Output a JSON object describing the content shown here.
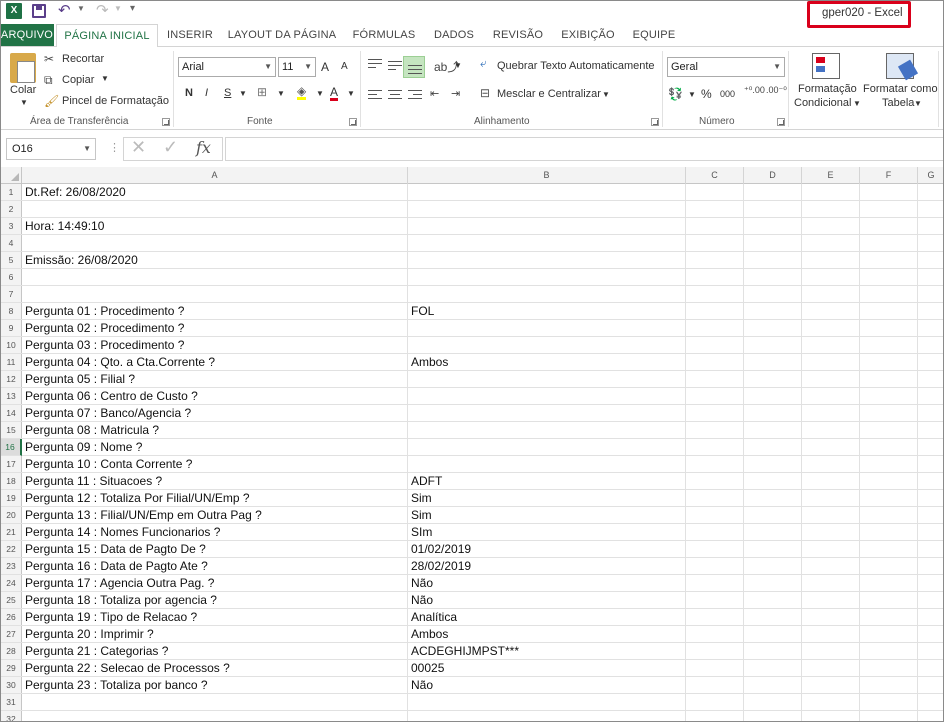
{
  "title_bar": {
    "title": "gper020 - Excel"
  },
  "quick_access": {
    "logo_letter": "X"
  },
  "ribbon_tabs": [
    "ARQUIVO",
    "PÁGINA INICIAL",
    "INSERIR",
    "LAYOUT DA PÁGINA",
    "FÓRMULAS",
    "DADOS",
    "REVISÃO",
    "EXIBIÇÃO",
    "EQUIPE"
  ],
  "clipboard": {
    "paste": "Colar",
    "cut": "Recortar",
    "copy": "Copiar",
    "format_painter": "Pincel de Formatação",
    "group_label": "Área de Transferência"
  },
  "font": {
    "name": "Arial",
    "size": "11",
    "grow": "A",
    "shrink": "A",
    "bold": "N",
    "italic": "I",
    "underline": "S",
    "color_letter": "A",
    "group_label": "Fonte"
  },
  "alignment": {
    "wrap_text": "Quebrar Texto Automaticamente",
    "merge_center": "Mesclar e Centralizar",
    "group_label": "Alinhamento"
  },
  "number": {
    "format": "Geral",
    "percent": "%",
    "thousands": "000",
    "group_label": "Número"
  },
  "styles": {
    "conditional_1": "Formatação",
    "conditional_2": "Condicional",
    "format_table_1": "Formatar como",
    "format_table_2": "Tabela"
  },
  "formula_bar": {
    "name_box": "O16",
    "fx": "fx",
    "content": ""
  },
  "columns": [
    "A",
    "B",
    "C",
    "D",
    "E",
    "F",
    "G"
  ],
  "selected_row": 16,
  "rows": [
    {
      "n": "1",
      "a": "Dt.Ref: 26/08/2020",
      "b": ""
    },
    {
      "n": "2",
      "a": "",
      "b": ""
    },
    {
      "n": "3",
      "a": "Hora: 14:49:10",
      "b": ""
    },
    {
      "n": "4",
      "a": "",
      "b": ""
    },
    {
      "n": "5",
      "a": "Emissão: 26/08/2020",
      "b": ""
    },
    {
      "n": "6",
      "a": "",
      "b": ""
    },
    {
      "n": "7",
      "a": "",
      "b": ""
    },
    {
      "n": "8",
      "a": "Pergunta 01 : Procedimento ?",
      "b": "FOL"
    },
    {
      "n": "9",
      "a": "Pergunta 02 : Procedimento ?",
      "b": ""
    },
    {
      "n": "10",
      "a": "Pergunta 03 : Procedimento ?",
      "b": ""
    },
    {
      "n": "11",
      "a": "Pergunta 04 : Qto. a Cta.Corrente ?",
      "b": "Ambos"
    },
    {
      "n": "12",
      "a": "Pergunta 05 : Filial ?",
      "b": ""
    },
    {
      "n": "13",
      "a": "Pergunta 06 : Centro de Custo ?",
      "b": ""
    },
    {
      "n": "14",
      "a": "Pergunta 07 : Banco/Agencia ?",
      "b": ""
    },
    {
      "n": "15",
      "a": "Pergunta 08 : Matricula ?",
      "b": ""
    },
    {
      "n": "16",
      "a": "Pergunta 09 : Nome ?",
      "b": ""
    },
    {
      "n": "17",
      "a": "Pergunta 10 : Conta Corrente ?",
      "b": ""
    },
    {
      "n": "18",
      "a": "Pergunta 11 : Situacoes ?",
      "b": " ADFT"
    },
    {
      "n": "19",
      "a": "Pergunta 12 : Totaliza Por Filial/UN/Emp ?",
      "b": "Sim"
    },
    {
      "n": "20",
      "a": "Pergunta 13 : Filial/UN/Emp em Outra Pag ?",
      "b": "Sim"
    },
    {
      "n": "21",
      "a": "Pergunta 14 : Nomes Funcionarios ?",
      "b": "SIm"
    },
    {
      "n": "22",
      "a": "Pergunta 15 : Data de Pagto De ?",
      "b": "01/02/2019"
    },
    {
      "n": "23",
      "a": "Pergunta 16 : Data de Pagto Ate ?",
      "b": "28/02/2019"
    },
    {
      "n": "24",
      "a": "Pergunta 17 : Agencia Outra Pag. ?",
      "b": "Não"
    },
    {
      "n": "25",
      "a": "Pergunta 18 : Totaliza por agencia ?",
      "b": "Não"
    },
    {
      "n": "26",
      "a": "Pergunta 19 : Tipo de Relacao ?",
      "b": "Analítica"
    },
    {
      "n": "27",
      "a": "Pergunta 20 : Imprimir ?",
      "b": "Ambos"
    },
    {
      "n": "28",
      "a": "Pergunta 21 : Categorias ?",
      "b": "ACDEGHIJMPST***"
    },
    {
      "n": "29",
      "a": "Pergunta 22 : Selecao de Processos ?",
      "b": "00025"
    },
    {
      "n": "30",
      "a": "Pergunta 23 : Totaliza por banco ?",
      "b": "Não"
    },
    {
      "n": "31",
      "a": "",
      "b": ""
    },
    {
      "n": "32",
      "a": "",
      "b": ""
    }
  ]
}
